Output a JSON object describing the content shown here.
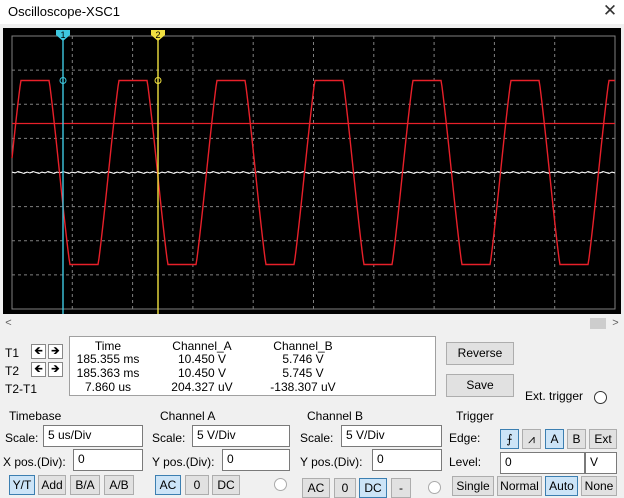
{
  "window": {
    "title": "Oscilloscope-XSC1",
    "close_glyph": "✕"
  },
  "screen": {
    "background": "#000000",
    "grid_color": "#808080",
    "channel_a_color": "#e8202a",
    "channel_b_color": "#ffffff",
    "cursor1_color": "#3ec8e0",
    "cursor2_color": "#f0e040",
    "cursor1_label": "1",
    "cursor2_label": "2"
  },
  "scrollbar": {
    "left_arrow": "<",
    "right_arrow": ">"
  },
  "readout": {
    "row_labels": [
      "T1",
      "T2",
      "T2-T1"
    ],
    "headers": {
      "time": "Time",
      "channel_a": "Channel_A",
      "channel_b": "Channel_B"
    },
    "t1": {
      "time": "185.355 ms",
      "channel_a": "10.450 V",
      "channel_b": "5.746 V"
    },
    "t2": {
      "time": "185.363 ms",
      "channel_a": "10.450 V",
      "channel_b": "5.745 V"
    },
    "t2_t1": {
      "time": "7.860 us",
      "channel_a": "204.327 uV",
      "channel_b": "-138.307 uV"
    },
    "arrow_left": "🡸",
    "arrow_right": "🡺"
  },
  "buttons": {
    "reverse": "Reverse",
    "save": "Save",
    "ext_trigger": "Ext. trigger"
  },
  "timebase": {
    "title": "Timebase",
    "scale_label": "Scale:",
    "scale_value": "5 us/Div",
    "xpos_label": "X pos.(Div):",
    "xpos_value": "0",
    "modes": [
      "Y/T",
      "Add",
      "B/A",
      "A/B"
    ]
  },
  "channel_a": {
    "title": "Channel A",
    "scale_label": "Scale:",
    "scale_value": "5  V/Div",
    "ypos_label": "Y pos.(Div):",
    "ypos_value": "0",
    "coupling": [
      "AC",
      "0",
      "DC"
    ]
  },
  "channel_b": {
    "title": "Channel B",
    "scale_label": "Scale:",
    "scale_value": "5  V/Div",
    "ypos_label": "Y pos.(Div):",
    "ypos_value": "0",
    "coupling": [
      "AC",
      "0",
      "DC",
      "-"
    ]
  },
  "trigger": {
    "title": "Trigger",
    "edge_label": "Edge:",
    "edge_rise": "⨍",
    "edge_fall": "⩘",
    "sources": [
      "A",
      "B",
      "Ext"
    ],
    "level_label": "Level:",
    "level_value": "0",
    "level_unit": "V",
    "modes": [
      "Single",
      "Normal",
      "Auto",
      "None"
    ]
  }
}
